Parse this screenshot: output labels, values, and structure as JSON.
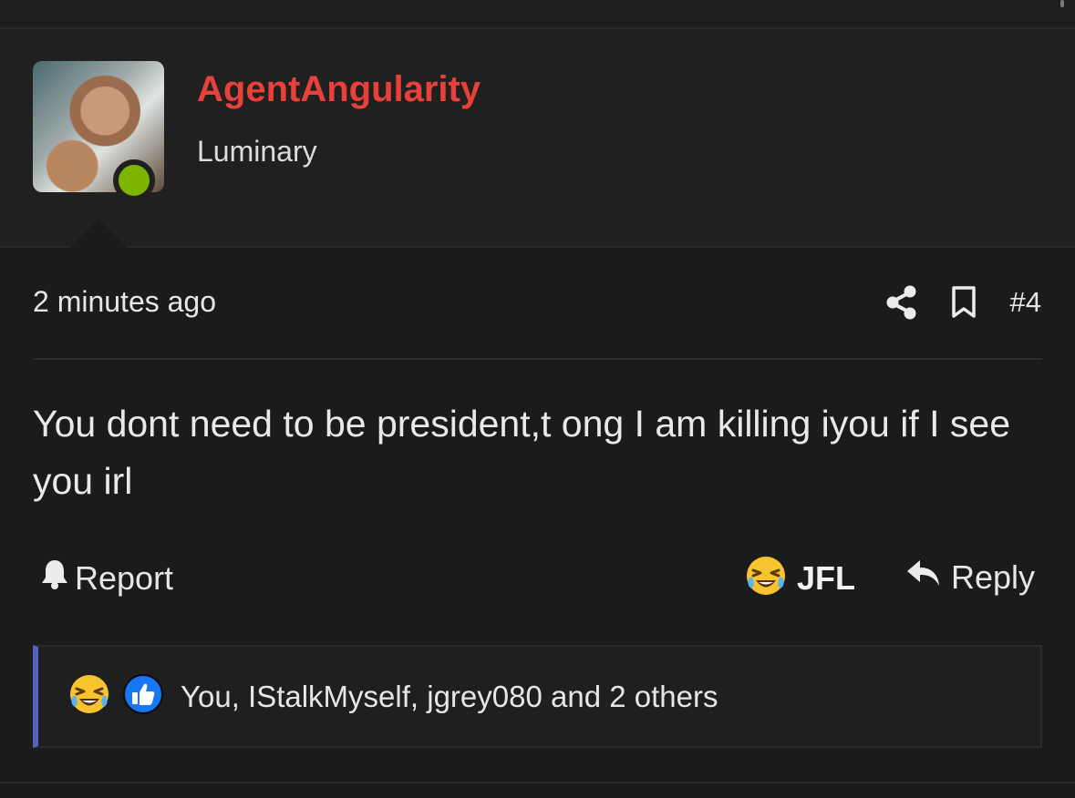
{
  "post": {
    "author": "AgentAngularity",
    "author_title": "Luminary",
    "online": true,
    "time": "2 minutes ago",
    "number": "#4",
    "message": "You dont need to be president,t ong I am killing iyou if I see you irl"
  },
  "actions": {
    "report_label": "Report",
    "reaction_label": "JFL",
    "reply_label": "Reply"
  },
  "reactions": {
    "text": "You, IStalkMyself, jgrey080 and 2 others",
    "icons": [
      "laughing-crying-emoji",
      "thumbs-up-icon"
    ]
  },
  "icons": {
    "share": "share-icon",
    "bookmark": "bookmark-icon",
    "report": "bell-icon",
    "reply": "reply-arrow-icon"
  },
  "colors": {
    "author": "#e8413a",
    "online": "#7bb500",
    "reaction_bar_accent": "#5662b8",
    "like": "#1877f2"
  }
}
